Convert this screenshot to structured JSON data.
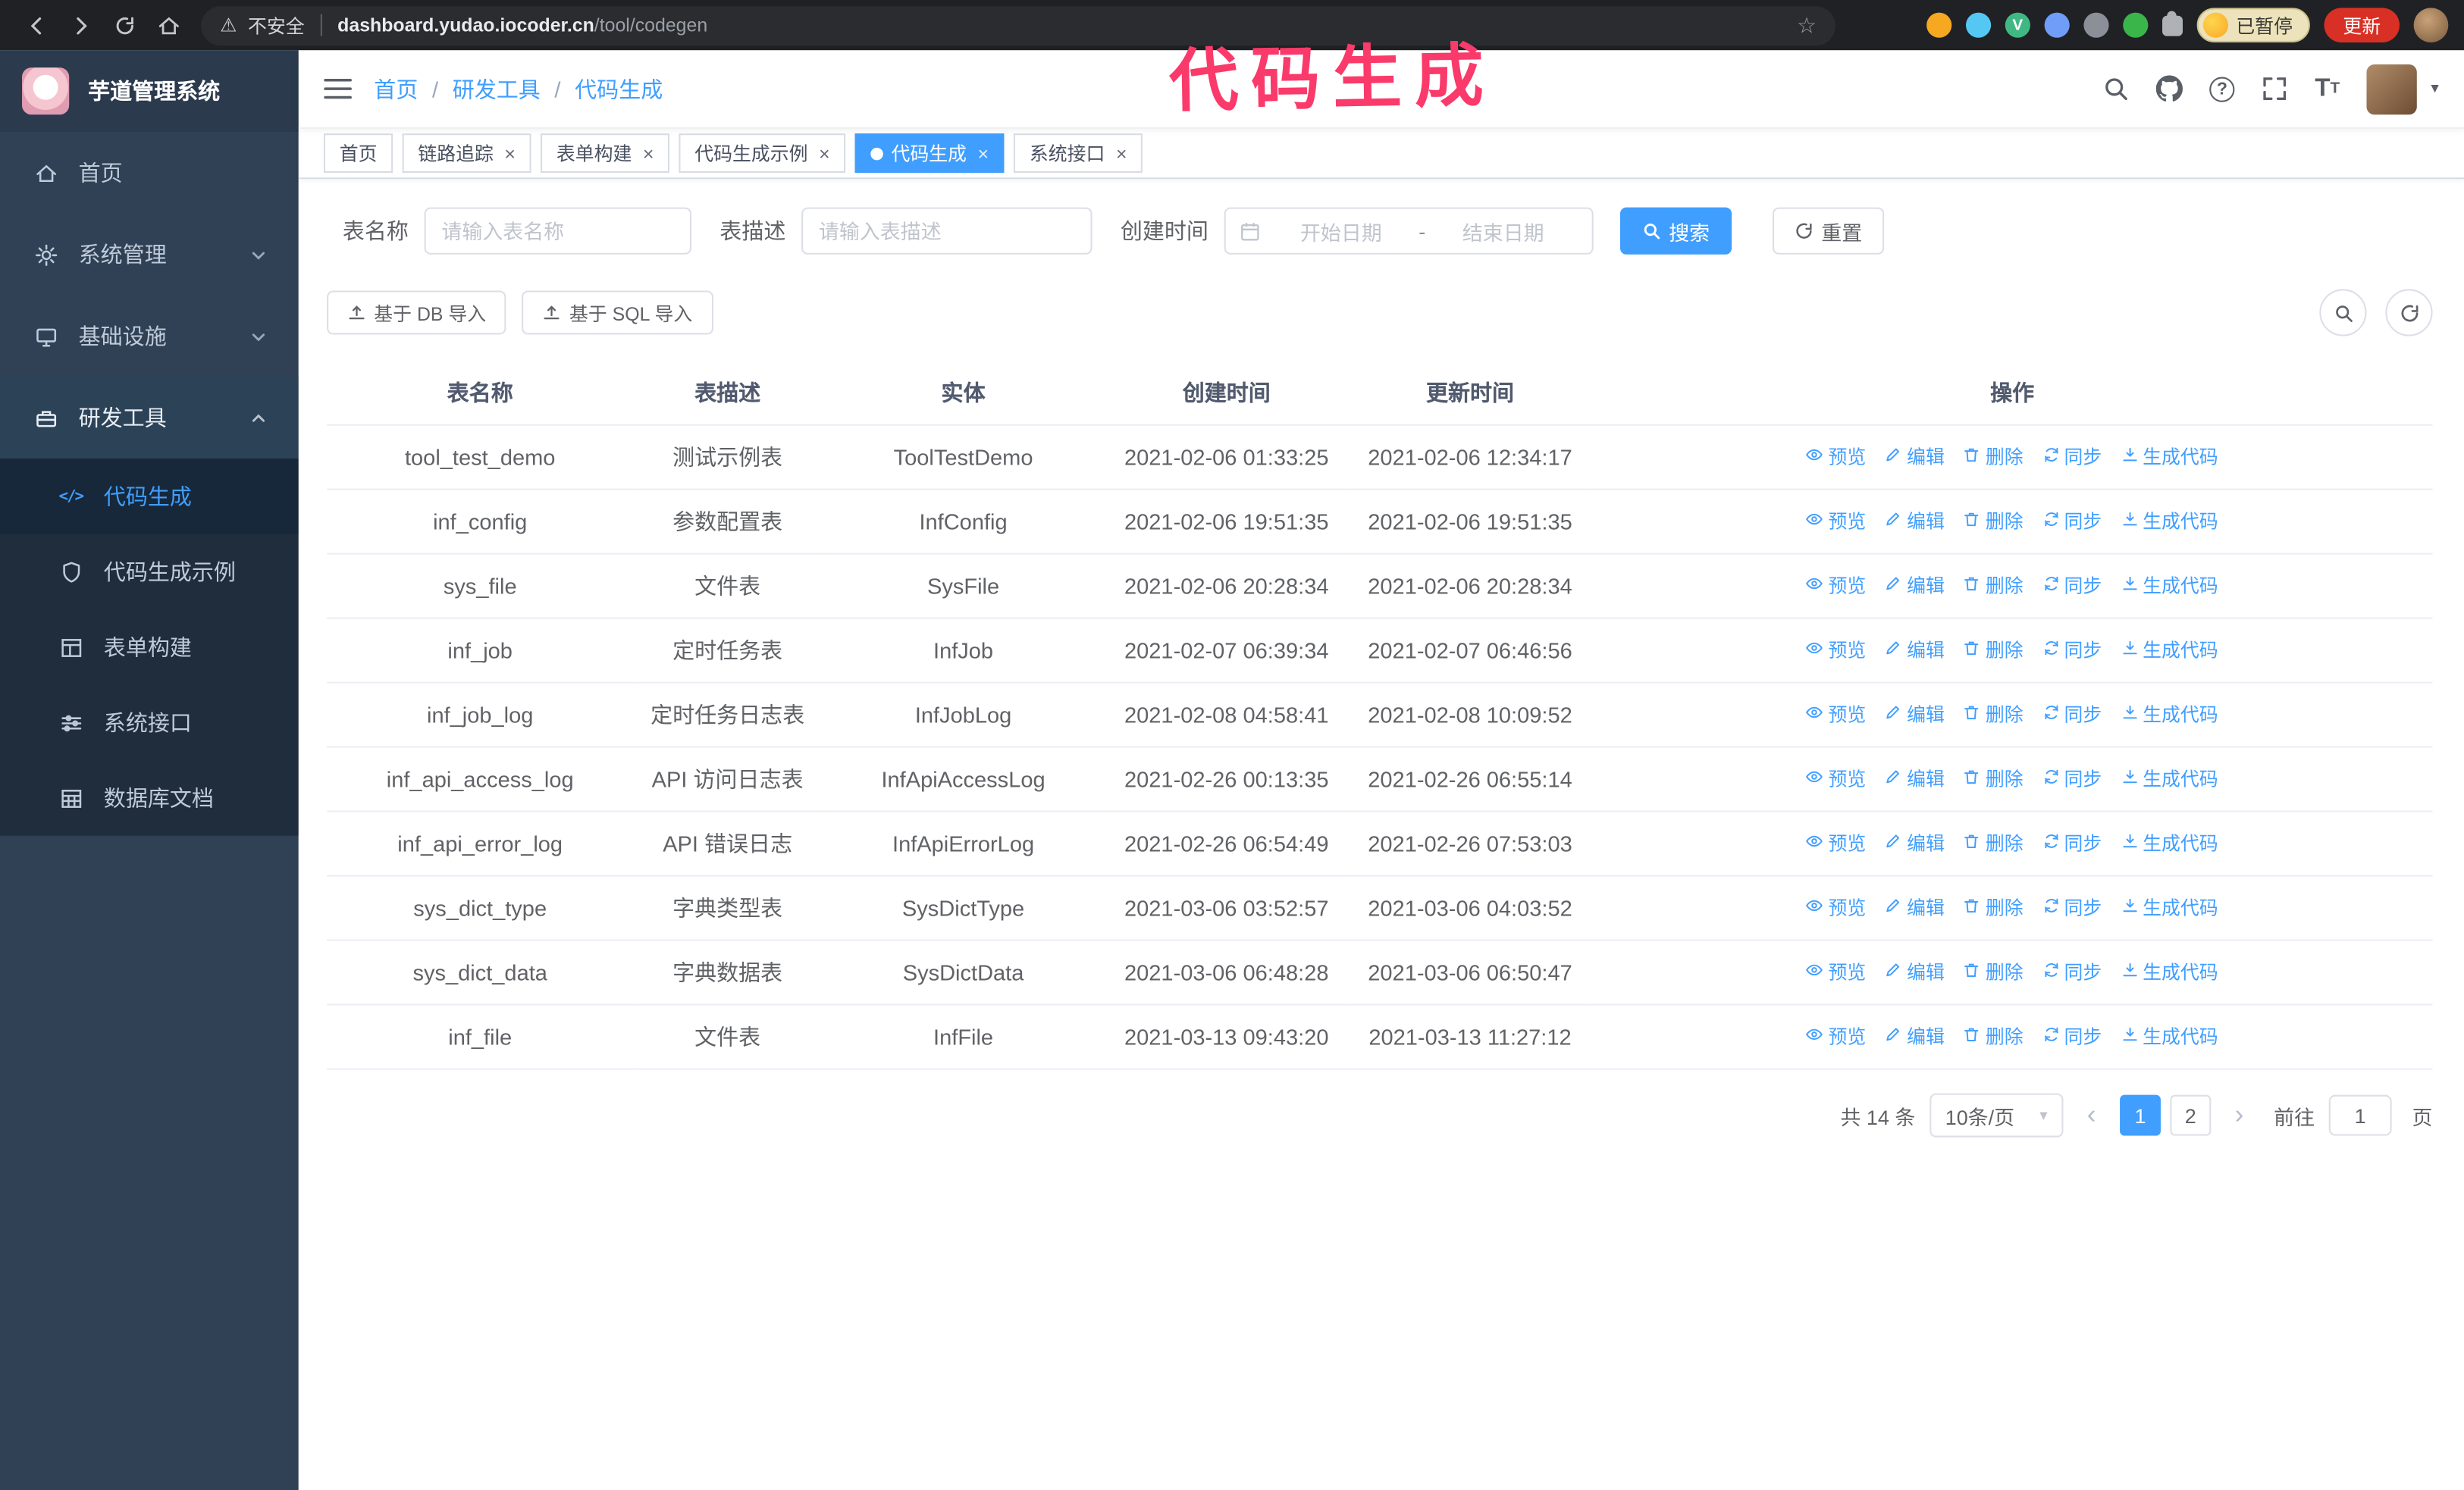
{
  "annotation": {
    "text": "代码生成",
    "color": "#fa3a6a"
  },
  "colors": {
    "accent": "#409eff",
    "sidebar_bg": "#304156",
    "tab_active": "#409eff",
    "update_button": "#d93025"
  },
  "browser": {
    "security_label": "不安全",
    "url_host": "dashboard.yudao.iocoder.cn",
    "url_path": "/tool/codegen",
    "paused_badge": "已暂停",
    "update_button": "更新"
  },
  "sidebar": {
    "logo_title": "芋道管理系统",
    "items": [
      {
        "label": "首页",
        "icon": "home-icon"
      },
      {
        "label": "系统管理",
        "icon": "system-icon",
        "expandable": true
      },
      {
        "label": "基础设施",
        "icon": "infra-icon",
        "expandable": true
      },
      {
        "label": "研发工具",
        "icon": "devtools-icon",
        "expanded": true
      }
    ],
    "subitems": [
      {
        "label": "代码生成",
        "icon": "code-icon",
        "active": true
      },
      {
        "label": "代码生成示例",
        "icon": "code-example-icon"
      },
      {
        "label": "表单构建",
        "icon": "form-builder-icon"
      },
      {
        "label": "系统接口",
        "icon": "api-icon"
      },
      {
        "label": "数据库文档",
        "icon": "db-doc-icon"
      }
    ]
  },
  "header": {
    "breadcrumb": [
      "首页",
      "研发工具",
      "代码生成"
    ],
    "icons": [
      "search-icon",
      "github-icon",
      "help-icon",
      "fullscreen-icon",
      "font-size-icon",
      "user-avatar",
      "chevron-down-icon"
    ]
  },
  "tabs": [
    {
      "label": "首页",
      "closable": false,
      "active": false
    },
    {
      "label": "链路追踪",
      "closable": true,
      "active": false
    },
    {
      "label": "表单构建",
      "closable": true,
      "active": false
    },
    {
      "label": "代码生成示例",
      "closable": true,
      "active": false
    },
    {
      "label": "代码生成",
      "closable": true,
      "active": true
    },
    {
      "label": "系统接口",
      "closable": true,
      "active": false
    }
  ],
  "filters": {
    "table_name_label": "表名称",
    "table_name_placeholder": "请输入表名称",
    "table_desc_label": "表描述",
    "table_desc_placeholder": "请输入表描述",
    "create_time_label": "创建时间",
    "date_start_placeholder": "开始日期",
    "date_separator": "-",
    "date_end_placeholder": "结束日期",
    "search_button": "搜索",
    "reset_button": "重置"
  },
  "toolbar": {
    "import_db_label": "基于 DB 导入",
    "import_sql_label": "基于 SQL 导入"
  },
  "table": {
    "columns": [
      "表名称",
      "表描述",
      "实体",
      "创建时间",
      "更新时间",
      "操作"
    ],
    "actions": [
      "预览",
      "编辑",
      "删除",
      "同步",
      "生成代码"
    ],
    "rows": [
      {
        "name": "tool_test_demo",
        "desc": "测试示例表",
        "entity": "ToolTestDemo",
        "created": "2021-02-06 01:33:25",
        "updated": "2021-02-06 12:34:17"
      },
      {
        "name": "inf_config",
        "desc": "参数配置表",
        "entity": "InfConfig",
        "created": "2021-02-06 19:51:35",
        "updated": "2021-02-06 19:51:35"
      },
      {
        "name": "sys_file",
        "desc": "文件表",
        "entity": "SysFile",
        "created": "2021-02-06 20:28:34",
        "updated": "2021-02-06 20:28:34"
      },
      {
        "name": "inf_job",
        "desc": "定时任务表",
        "entity": "InfJob",
        "created": "2021-02-07 06:39:34",
        "updated": "2021-02-07 06:46:56"
      },
      {
        "name": "inf_job_log",
        "desc": "定时任务日志表",
        "entity": "InfJobLog",
        "created": "2021-02-08 04:58:41",
        "updated": "2021-02-08 10:09:52"
      },
      {
        "name": "inf_api_access_log",
        "desc": "API 访问日志表",
        "entity": "InfApiAccessLog",
        "created": "2021-02-26 00:13:35",
        "updated": "2021-02-26 06:55:14"
      },
      {
        "name": "inf_api_error_log",
        "desc": "API 错误日志",
        "entity": "InfApiErrorLog",
        "created": "2021-02-26 06:54:49",
        "updated": "2021-02-26 07:53:03"
      },
      {
        "name": "sys_dict_type",
        "desc": "字典类型表",
        "entity": "SysDictType",
        "created": "2021-03-06 03:52:57",
        "updated": "2021-03-06 04:03:52"
      },
      {
        "name": "sys_dict_data",
        "desc": "字典数据表",
        "entity": "SysDictData",
        "created": "2021-03-06 06:48:28",
        "updated": "2021-03-06 06:50:47"
      },
      {
        "name": "inf_file",
        "desc": "文件表",
        "entity": "InfFile",
        "created": "2021-03-13 09:43:20",
        "updated": "2021-03-13 11:27:12"
      }
    ]
  },
  "pagination": {
    "total": "共 14 条",
    "page_size": "10条/页",
    "pages": [
      "1",
      "2"
    ],
    "active_page": "1",
    "goto_prefix": "前往",
    "goto_value": "1",
    "goto_suffix": "页"
  }
}
